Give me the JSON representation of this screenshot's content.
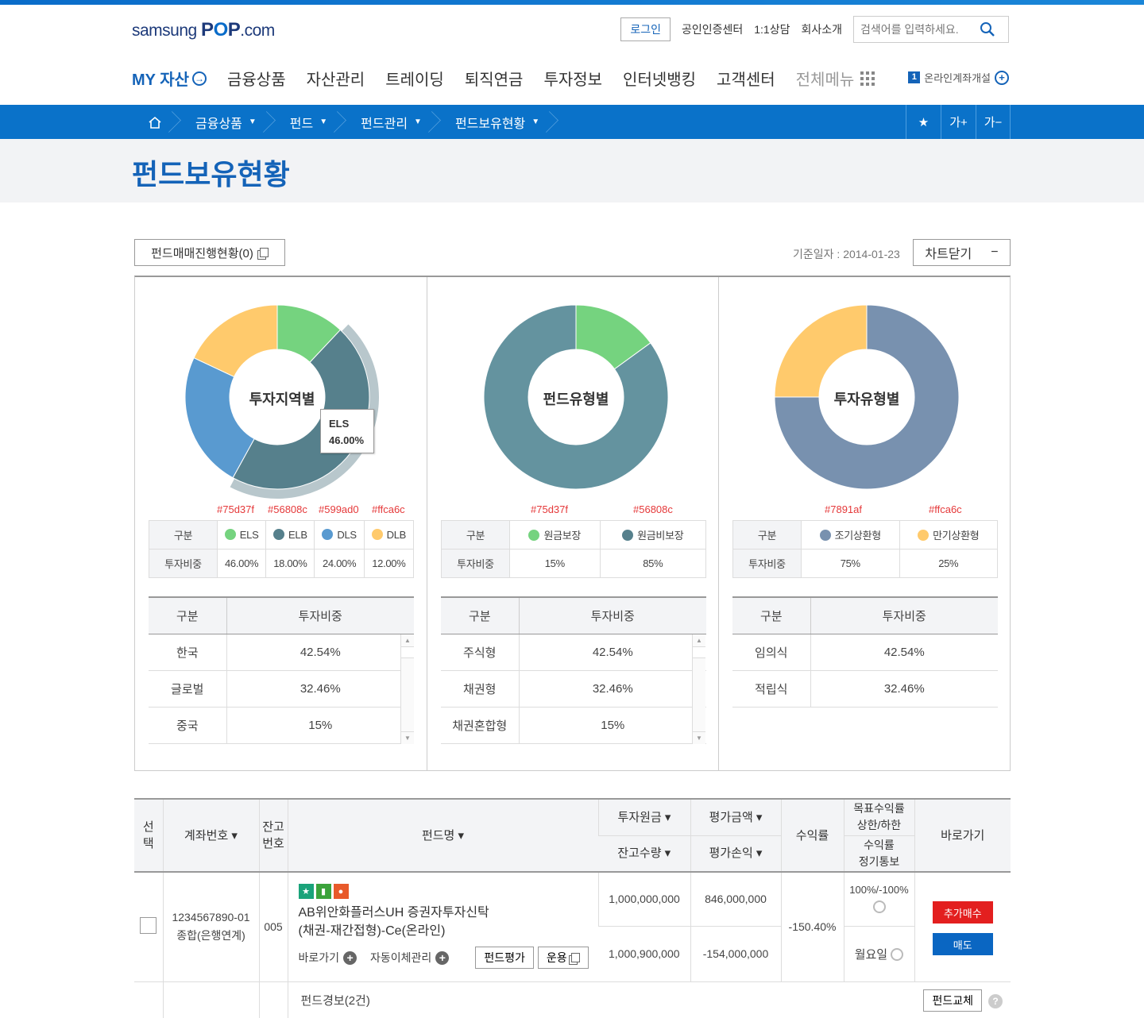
{
  "header": {
    "logo_prefix": "samsung ",
    "logo_brand_1": "P",
    "logo_brand_o": "O",
    "logo_brand_2": "P",
    "logo_suffix": ".com",
    "util": {
      "login": "로그인",
      "cert": "공인인증센터",
      "consult": "1:1상담",
      "about": "회사소개",
      "search_placeholder": "검색어를 입력하세요."
    },
    "gnb": [
      "금융상품",
      "자산관리",
      "트레이딩",
      "퇴직연금",
      "투자정보",
      "인터넷뱅킹",
      "고객센터"
    ],
    "gnb_my": "MY 자산",
    "gnb_all": "전체메뉴",
    "open_account_num": "1",
    "open_account": "온라인계좌개설"
  },
  "breadcrumb": [
    "금융상품",
    "펀드",
    "펀드관리",
    "펀드보유현황"
  ],
  "tools": {
    "font_up": "가+",
    "font_down": "가−"
  },
  "page_title": "펀드보유현황",
  "toolbar": {
    "trade_status": "펀드매매진행현황(0)",
    "base_date": "기준일자 : 2014-01-23",
    "chart_close": "차트닫기"
  },
  "charts": [
    {
      "title": "투자지역별",
      "hex_labels": [
        "#75d37f",
        "#56808c",
        "#599ad0",
        "#ffca6c"
      ],
      "row_head": [
        "구분",
        "투자비중"
      ],
      "legend": [
        {
          "name": "ELS",
          "value": "46.00%",
          "color": "#56808c"
        },
        {
          "name": "ELB",
          "value": "18.00%",
          "color": "#56808c"
        },
        {
          "name": "DLS",
          "value": "24.00%",
          "color": "#599ad0"
        },
        {
          "name": "DLB",
          "value": "12.00%",
          "color": "#ffca6c"
        }
      ],
      "tooltip": {
        "name": "ELS",
        "value": "46.00%"
      },
      "ratio_head": [
        "구분",
        "투자비중"
      ],
      "ratio_rows": [
        [
          "한국",
          "42.54%"
        ],
        [
          "글로벌",
          "32.46%"
        ],
        [
          "중국",
          "15%"
        ]
      ]
    },
    {
      "title": "펀드유형별",
      "hex_labels": [
        "#75d37f",
        "#56808c"
      ],
      "row_head": [
        "구분",
        "투자비중"
      ],
      "legend": [
        {
          "name": "원금보장",
          "value": "15%",
          "color": "#75d37f"
        },
        {
          "name": "원금비보장",
          "value": "85%",
          "color": "#56808c"
        }
      ],
      "ratio_head": [
        "구분",
        "투자비중"
      ],
      "ratio_rows": [
        [
          "주식형",
          "42.54%"
        ],
        [
          "채권형",
          "32.46%"
        ],
        [
          "채권혼합형",
          "15%"
        ]
      ]
    },
    {
      "title": "투자유형별",
      "hex_labels": [
        "#7891af",
        "#ffca6c"
      ],
      "row_head": [
        "구분",
        "투자비중"
      ],
      "legend": [
        {
          "name": "조기상환형",
          "value": "75%",
          "color": "#7891af"
        },
        {
          "name": "만기상환형",
          "value": "25%",
          "color": "#ffca6c"
        }
      ],
      "ratio_head": [
        "구분",
        "투자비중"
      ],
      "ratio_rows": [
        [
          "임의식",
          "42.54%"
        ],
        [
          "적립식",
          "32.46%"
        ]
      ]
    }
  ],
  "donut_slices": [
    [
      {
        "pct": 12,
        "color": "#75d37f"
      },
      {
        "pct": 46,
        "color": "#56808c"
      },
      {
        "pct": 24,
        "color": "#599ad0"
      },
      {
        "pct": 18,
        "color": "#ffca6c"
      }
    ],
    [
      {
        "pct": 15,
        "color": "#75d37f"
      },
      {
        "pct": 85,
        "color": "#64939f"
      }
    ],
    [
      {
        "pct": 75,
        "color": "#7891af"
      },
      {
        "pct": 25,
        "color": "#ffca6c"
      }
    ]
  ],
  "holdings": {
    "head": {
      "select": "선\n택",
      "account": "계좌번호 ▾",
      "balance_no": "잔고\n번호",
      "fund_name": "펀드명 ▾",
      "principal": "투자원금 ▾",
      "qty": "잔고수량 ▾",
      "eval_amt": "평가금액 ▾",
      "eval_pl": "평가손익 ▾",
      "yield": "수익률",
      "target": "목표수익률\n상한/하한",
      "notice": "수익률\n정기통보",
      "goto": "바로가기"
    },
    "row": {
      "account": "1234567890-01",
      "account_type": "종합(은행연계)",
      "balance_no": "005",
      "fund_name_1": "AB위안화플러스UH 증권자투자신탁",
      "fund_name_2": "(채권-재간접형)-Ce(온라인)",
      "link_goto": "바로가기",
      "link_auto": "자동이체관리",
      "btn_eval": "펀드평가",
      "btn_oper": "운용",
      "principal": "1,000,000,000",
      "qty": "1,000,900,000",
      "eval_amt": "846,000,000",
      "eval_pl": "-154,000,000",
      "yield": "-150.40%",
      "target": "100%/-100%",
      "notice": "월요일",
      "buy_more": "추가매수",
      "sell": "매도",
      "alert": "펀드경보(2건)",
      "swap": "펀드교체"
    }
  }
}
